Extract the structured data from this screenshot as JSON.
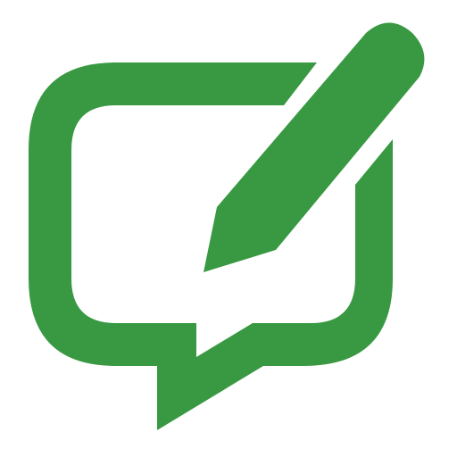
{
  "icon": {
    "name": "compose-message-icon",
    "parts": [
      "speech-bubble-icon",
      "pencil-icon"
    ],
    "color": "#389942",
    "background": "#ffffff"
  }
}
